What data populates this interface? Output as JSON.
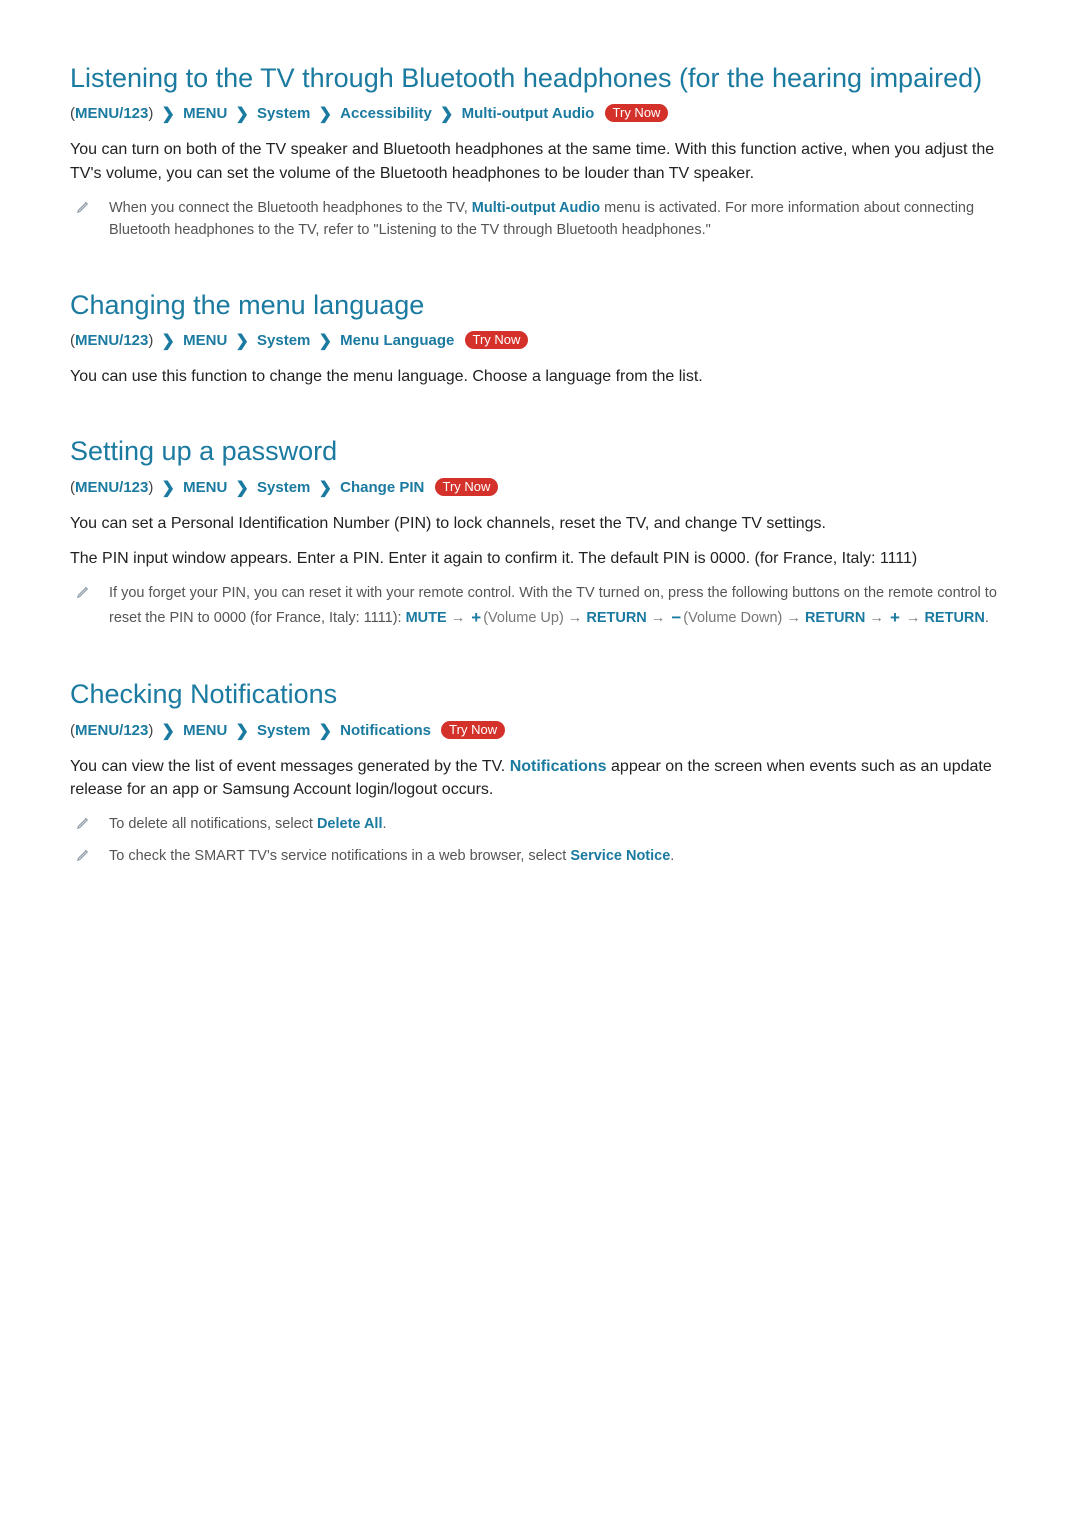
{
  "sections": [
    {
      "title": "Listening to the TV through Bluetooth headphones (for the hearing impaired)",
      "crumb": {
        "root": "MENU/123",
        "items": [
          "MENU",
          "System",
          "Accessibility",
          "Multi-output Audio"
        ],
        "try_now": "Try Now"
      },
      "paras": [
        "You can turn on both of the TV speaker and Bluetooth headphones at the same time. With this function active, when you adjust the TV's volume, you can set the volume of the Bluetooth headphones to be louder than TV speaker."
      ],
      "notes": [
        {
          "pre": "When you connect the Bluetooth headphones to the TV, ",
          "blue": "Multi-output Audio",
          "post": " menu is activated. For more information about connecting Bluetooth headphones to the TV, refer to \"Listening to the TV through Bluetooth headphones.\""
        }
      ]
    },
    {
      "title": "Changing the menu language",
      "crumb": {
        "root": "MENU/123",
        "items": [
          "MENU",
          "System",
          "Menu Language"
        ],
        "try_now": "Try Now"
      },
      "paras": [
        "You can use this function to change the menu language. Choose a language from the list."
      ],
      "notes": []
    },
    {
      "title": "Setting up a password",
      "crumb": {
        "root": "MENU/123",
        "items": [
          "MENU",
          "System",
          "Change PIN"
        ],
        "try_now": "Try Now"
      },
      "paras": [
        "You can set a Personal Identification Number (PIN) to lock channels, reset the TV, and change TV settings.",
        "The PIN input window appears. Enter a PIN. Enter it again to confirm it. The default PIN is 0000. (for France, Italy: 1111)"
      ],
      "pin_note": {
        "line1": "If you forget your PIN, you can reset it with your remote control. With the TV turned on, press the following buttons on the remote control to reset the PIN to 0000 (for France, Italy: 1111): ",
        "mute": "MUTE",
        "volup": "(Volume Up)",
        "ret": "RETURN",
        "voldown": "(Volume Down)",
        "arrow": " → "
      },
      "notes": []
    },
    {
      "title": "Checking Notifications",
      "crumb": {
        "root": "MENU/123",
        "items": [
          "MENU",
          "System",
          "Notifications"
        ],
        "try_now": "Try Now"
      },
      "para_parts": {
        "pre": "You can view the list of event messages generated by the TV. ",
        "blue": "Notifications",
        "post": " appear on the screen when events such as an update release for an app or Samsung Account login/logout occurs."
      },
      "notes": [
        {
          "pre": "To delete all notifications, select ",
          "blue": "Delete All",
          "post": "."
        },
        {
          "pre": "To check the SMART TV's service notifications in a web browser, select ",
          "blue": "Service Notice",
          "post": "."
        }
      ]
    }
  ]
}
